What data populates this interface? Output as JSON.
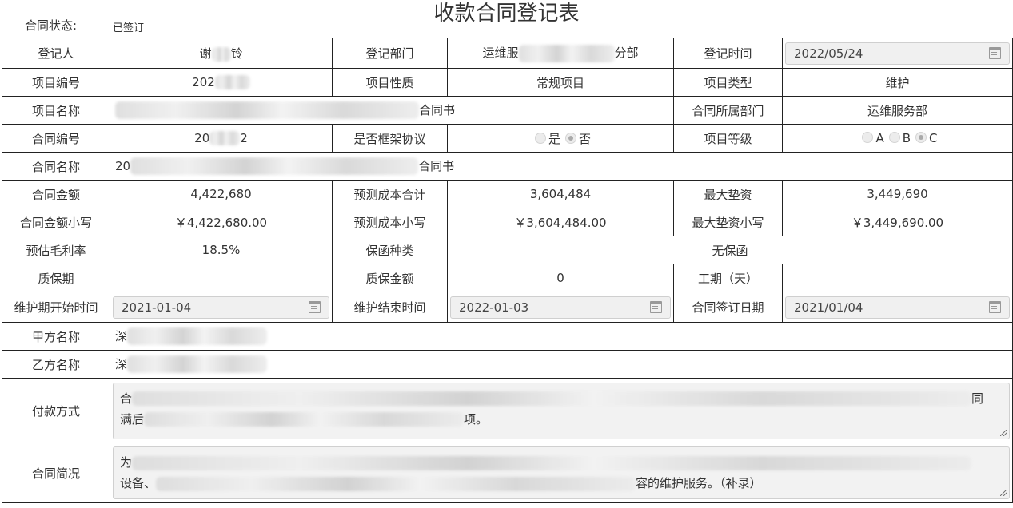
{
  "header": {
    "status_label": "合同状态:",
    "status_value": "已签订",
    "title": "收款合同登记表"
  },
  "rows": {
    "registrant_label": "登记人",
    "registrant_value": "谢",
    "registrant_tail": "铃",
    "dept_label": "登记部门",
    "dept_value_head": "运维服",
    "dept_value_tail": "分部",
    "reg_time_label": "登记时间",
    "reg_time_value": "2022/05/24",
    "project_no_label": "项目编号",
    "project_no_value": "202",
    "project_nature_label": "项目性质",
    "project_nature_value": "常规项目",
    "project_type_label": "项目类型",
    "project_type_value": "维护",
    "project_name_label": "项目名称",
    "project_name_tail": "合同书",
    "contract_dept_label": "合同所属部门",
    "contract_dept_value": "运维服务部",
    "contract_no_label": "合同编号",
    "contract_no_head": "20",
    "contract_no_tail": "2",
    "framework_label": "是否框架协议",
    "framework_yes": "是",
    "framework_no": "否",
    "project_level_label": "项目等级",
    "level_a": "A",
    "level_b": "B",
    "level_c": "C",
    "contract_name_label": "合同名称",
    "contract_name_head": "20",
    "contract_name_tail": "合同书",
    "amount_label": "合同金额",
    "amount_value": "4,422,680",
    "cost_total_label": "预测成本合计",
    "cost_total_value": "3,604,484",
    "max_advance_label": "最大垫资",
    "max_advance_value": "3,449,690",
    "amount_small_label": "合同金额小写",
    "amount_small_value": "￥4,422,680.00",
    "cost_small_label": "预测成本小写",
    "cost_small_value": "￥3,604,484.00",
    "max_advance_small_label": "最大垫资小写",
    "max_advance_small_value": "￥3,449,690.00",
    "gross_margin_label": "预估毛利率",
    "gross_margin_value": "18.5%",
    "guarantee_type_label": "保函种类",
    "guarantee_type_value": "无保函",
    "warranty_period_label": "质保期",
    "warranty_period_value": "",
    "warranty_amount_label": "质保金额",
    "warranty_amount_value": "0",
    "duration_label": "工期（天）",
    "duration_value": "",
    "maint_start_label": "维护期开始时间",
    "maint_start_value": "2021-01-04",
    "maint_end_label": "维护结束时间",
    "maint_end_value": "2022-01-03",
    "sign_date_label": "合同签订日期",
    "sign_date_value": "2021/01/04",
    "party_a_label": "甲方名称",
    "party_a_head": "深",
    "party_b_label": "乙方名称",
    "party_b_head": "深",
    "payment_label": "付款方式",
    "payment_line1_head": "合",
    "payment_line1_tail": "同",
    "payment_line2_head": "满后",
    "payment_line2_tail": "项。",
    "summary_label": "合同简况",
    "summary_line1_head": "为",
    "summary_line2_head": "设备、",
    "summary_line2_tail": "容的维护服务。（补录）"
  },
  "icons": {
    "date": "calendar-icon",
    "resize": "resize-handle-icon"
  }
}
